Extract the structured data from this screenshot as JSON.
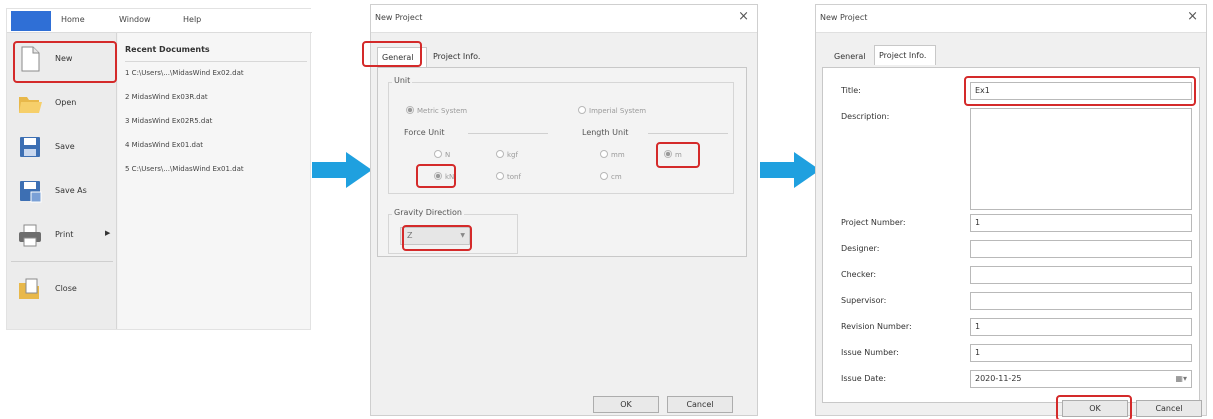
{
  "file_menu": {
    "tabs": [
      "Home",
      "Window",
      "Help"
    ],
    "items": [
      {
        "label": "New",
        "icon": "new-document-icon"
      },
      {
        "label": "Open",
        "icon": "open-folder-icon"
      },
      {
        "label": "Save",
        "icon": "floppy-disk-icon"
      },
      {
        "label": "Save As",
        "icon": "save-as-icon"
      },
      {
        "label": "Print",
        "icon": "printer-icon",
        "submenu": true
      },
      {
        "label": "Close",
        "icon": "close-document-icon"
      }
    ],
    "recent_title": "Recent Documents",
    "recent": [
      "1 C:\\Users\\...\\MidasWind Ex02.dat",
      "2 MidasWind Ex03R.dat",
      "3 MidasWind Ex02R5.dat",
      "4 MidasWind Ex01.dat",
      "5 C:\\Users\\...\\MidasWind Ex01.dat"
    ]
  },
  "dialog_general": {
    "title": "New Project",
    "close": "×",
    "tabs": [
      "General",
      "Project Info."
    ],
    "unit_label": "Unit",
    "metric": "Metric System",
    "imperial": "Imperial System",
    "force_label": "Force Unit",
    "length_label": "Length Unit",
    "force_options": [
      "N",
      "kgf",
      "kN",
      "tonf"
    ],
    "length_options": [
      "mm",
      "m",
      "cm"
    ],
    "gravity_label": "Gravity Direction",
    "gravity_value": "Z",
    "ok": "OK",
    "cancel": "Cancel"
  },
  "dialog_info": {
    "title": "New Project",
    "close": "×",
    "tabs": [
      "General",
      "Project Info."
    ],
    "fields": {
      "title_label": "Title:",
      "title_value": "Ex1",
      "description_label": "Description:",
      "project_number_label": "Project Number:",
      "project_number_value": "1",
      "designer_label": "Designer:",
      "checker_label": "Checker:",
      "supervisor_label": "Supervisor:",
      "revision_label": "Revision Number:",
      "revision_value": "1",
      "issue_number_label": "Issue Number:",
      "issue_number_value": "1",
      "issue_date_label": "Issue Date:",
      "issue_date_value": "2020-11-25"
    },
    "ok": "OK",
    "cancel": "Cancel"
  },
  "colors": {
    "highlight": "#d42a2a",
    "arrow": "#1fa0df",
    "file_tab": "#2f6fd6"
  }
}
